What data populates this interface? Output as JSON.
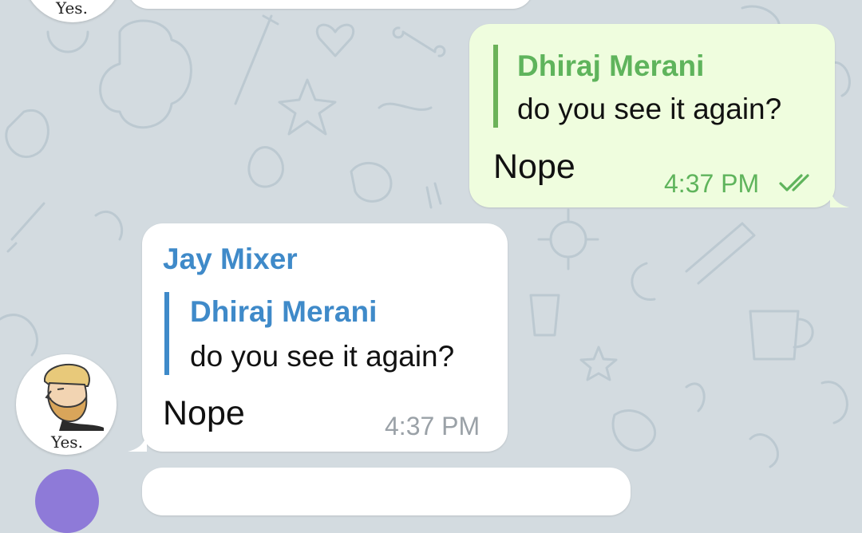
{
  "colors": {
    "background": "#d3dbe0",
    "incoming_bubble": "#ffffff",
    "outgoing_bubble": "#effdde",
    "outgoing_accent": "#5fb45c",
    "incoming_accent": "#3f8ac9",
    "incoming_time": "#9aa1a7"
  },
  "top_avatar": {
    "caption": "Yes."
  },
  "outgoing_message": {
    "reply": {
      "name": "Dhiraj Merani",
      "text": "do you see it again?"
    },
    "text": "Nope",
    "time": "4:37 PM",
    "status_icon": "double-check-icon"
  },
  "incoming_message": {
    "sender": "Jay Mixer",
    "reply": {
      "name": "Dhiraj Merani",
      "text": "do you see it again?"
    },
    "text": "Nope",
    "time": "4:37 PM"
  },
  "incoming_avatar": {
    "caption": "Yes.",
    "icon": "bearded-man-avatar"
  },
  "bottom_avatar": {
    "icon": "purple-avatar"
  }
}
